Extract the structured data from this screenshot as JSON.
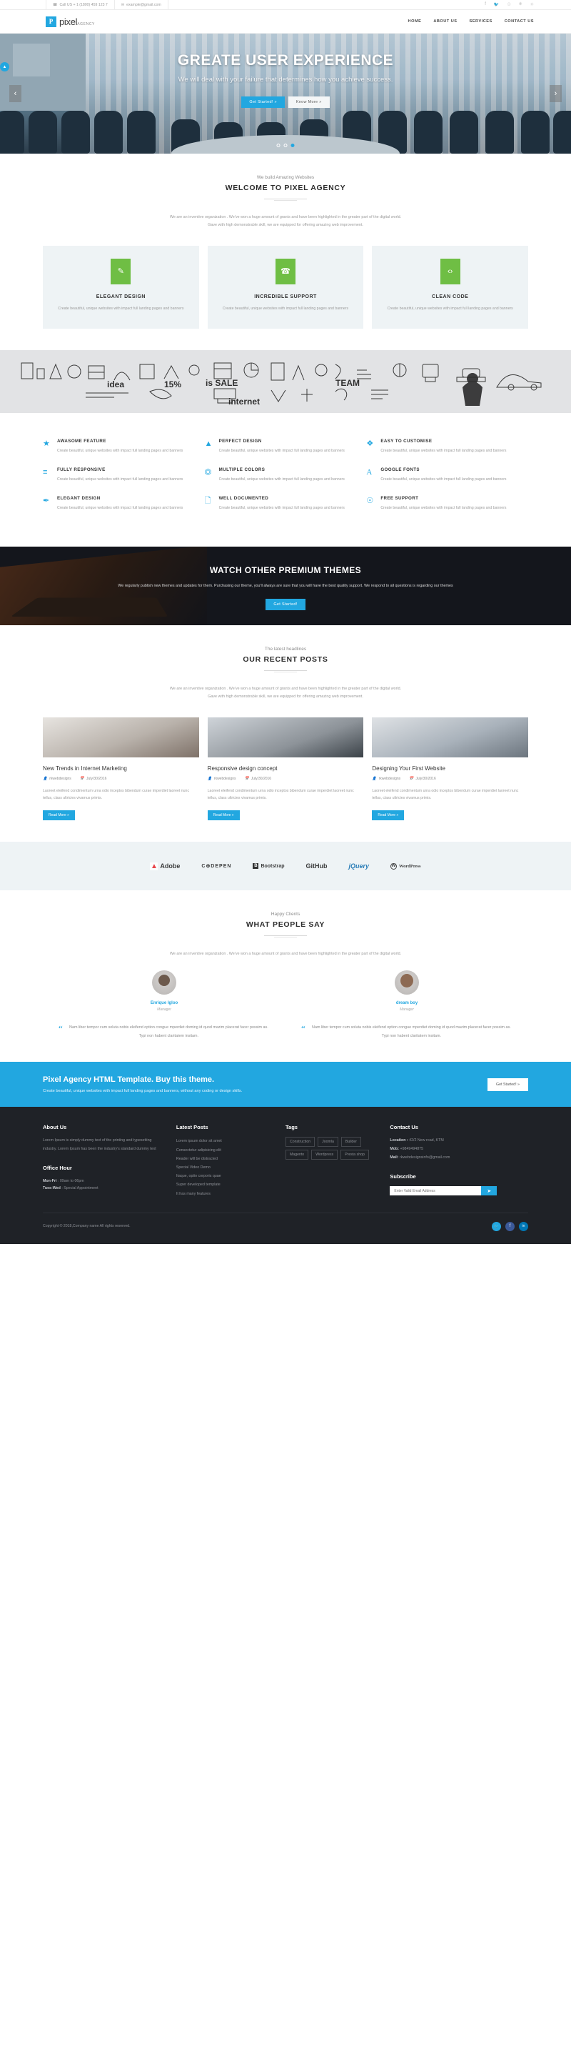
{
  "topbar": {
    "phone": "Call US + 1 (1800) 459 123 7",
    "email": "example@gmail.com",
    "socials": [
      "f",
      "✉",
      "ⓟ",
      "Ⓖ",
      "ⓖ"
    ]
  },
  "brand": {
    "mark": "P",
    "name": "pixel",
    "suffix": "AGENCY"
  },
  "nav": {
    "items": [
      "HOME",
      "ABOUT US",
      "SERVICES",
      "CONTACT US"
    ]
  },
  "hero": {
    "title": "GREATE USER EXPERIENCE",
    "subtitle": "We will deal with your failure that determines how you achieve success.",
    "primary_btn": "Get Started! »",
    "secondary_btn": "Know More »",
    "prev": "‹",
    "next": "›",
    "badge": "▲"
  },
  "welcome": {
    "eyebrow": "We build Amazing Websites",
    "title": "WELCOME TO PIXEL AGENCY",
    "desc_line1": "We are an inventive organization . We've won a huge amount of grants and have been highlighted in the greater part of the digital world.",
    "desc_line2": "Gave with high demonstrable skill, we are equipped for offering amazing web improvement.",
    "cards": [
      {
        "icon": "brush-icon",
        "glyph": "✎",
        "title": "ELEGANT DESIGN",
        "desc": "Create beautiful, unique websites with impact full landing pages and banners"
      },
      {
        "icon": "phone-icon",
        "glyph": "☎",
        "title": "INCREDIBLE SUPPORT",
        "desc": "Create beautiful, unique websites with impact full landing pages and banners"
      },
      {
        "icon": "code-icon",
        "glyph": "‹›",
        "title": "CLEAN CODE",
        "desc": "Create beautiful, unique websites with impact full landing pages and banners"
      }
    ]
  },
  "features": [
    {
      "icon": "star-icon",
      "glyph": "★",
      "title": "AWASOME FEATURE",
      "desc": "Create beautiful, unique websites with impact full landing pages and banners"
    },
    {
      "icon": "graduation-cap-icon",
      "glyph": "Ἱ3",
      "title": "PERFECT DESIGN",
      "desc": "Create beautiful, unique websites with impact full landing pages and banners"
    },
    {
      "icon": "puzzle-icon",
      "glyph": "❖",
      "title": "EASY TO CUSTOMISE",
      "desc": "Create beautiful, unique websites with impact full landing pages and banners"
    },
    {
      "icon": "bars-icon",
      "glyph": "≡",
      "title": "FULLY RESPONSIVE",
      "desc": "Create beautiful, unique websites with impact full landing pages and banners"
    },
    {
      "icon": "crop-icon",
      "glyph": "⌘",
      "title": "MULTIPLE COLORS",
      "desc": "Create beautiful, unique websites with impact full landing pages and banners"
    },
    {
      "icon": "font-icon",
      "glyph": "A",
      "title": "GOOGLE FONTS",
      "desc": "Create beautiful, unique websites with impact full landing pages and banners"
    },
    {
      "icon": "paintbrush-icon",
      "glyph": "✒",
      "title": "ELEGANT DESIGN",
      "desc": "Create beautiful, unique websites with impact full landing pages and banners"
    },
    {
      "icon": "document-icon",
      "glyph": "☷",
      "title": "WELL DOCUMENTED",
      "desc": "Create beautiful, unique websites with impact full landing pages and banners"
    },
    {
      "icon": "lifebuoy-icon",
      "glyph": "☉",
      "title": "FREE SUPPORT",
      "desc": "Create beautiful, unique websites with impact full landing pages and banners"
    }
  ],
  "dark_cta": {
    "title": "WATCH OTHER PREMIUM THEMES",
    "desc": "We regularly publish new themes and updates for them. Purchasing our theme, you'll always are sure that you will have the best quality support. We respond to all questions is regarding our themes",
    "btn": "Get Started!"
  },
  "blog": {
    "eyebrow": "The latest headlines",
    "title": "OUR RECENT POSTS",
    "desc_line1": "We are an inventive organization . We've won a huge amount of grants and have been highlighted in the greater part of the digital world.",
    "desc_line2": "Gave with high demonstrable skill, we are equipped for offering amazing web improvement.",
    "posts": [
      {
        "title": "New Trends in Internet Marketing",
        "author": "rkwebdesigns",
        "date": "July/30/2016",
        "excerpt": "Laoreet eleifend condimentum urna odio inceptos bibendum curae imperdiet laoreet nunc tellus, class ultricies vivamus primis.",
        "btn": "Read More »"
      },
      {
        "title": "Responsive design concept",
        "author": "rkwebdesigns",
        "date": "July/30/2016",
        "excerpt": "Laoreet eleifend condimentum urna odio inceptos bibendum curae imperdiet laoreet nunc tellus, class ultricies vivamus primis.",
        "btn": "Read More »"
      },
      {
        "title": "Designing Your First Website",
        "author": "rkwebdesigns",
        "date": "July/30/2016",
        "excerpt": "Laoreet eleifend condimentum urna odio inceptos bibendum curae imperdiet laoreet nunc tellus, class ultricies vivamus primis.",
        "btn": "Read More »"
      }
    ]
  },
  "clients": [
    {
      "name": "Adobe",
      "icon": "adobe-logo"
    },
    {
      "name": "C⊕DEPEN",
      "icon": "codepen-logo"
    },
    {
      "name": "Bootstrap",
      "icon": "bootstrap-logo"
    },
    {
      "name": "GitHub",
      "icon": "github-logo"
    },
    {
      "name": "jQuery",
      "icon": "jquery-logo"
    },
    {
      "name": "WordPress",
      "icon": "wordpress-logo"
    }
  ],
  "testimonials": {
    "eyebrow": "Happy Clients",
    "title": "WHAT PEOPLE SAY",
    "desc": "We are an inventive organization . We've won a huge amount of grants and have been highlighted in the greater part of the digital world.",
    "items": [
      {
        "name": "Enrique Igloo",
        "role": "Manager",
        "quote": "Nam liber tempor cum soluta nobis eleifend option congue mperdiet doming id quod mazim placerat facer possim as. Typi non habent claritatem insitam."
      },
      {
        "name": "dream boy",
        "role": "Manager",
        "quote": "Nam liber tempor cum soluta nobis eleifend option congue mperdiet doming id quod mazim placerat facer possim as. Typi non habent claritatem insitam."
      }
    ]
  },
  "blue_cta": {
    "title": "Pixel Agency HTML Template. Buy this theme.",
    "desc": "Create beautiful, unique websites with impact full landing pages and banners, without any coding or design skills.",
    "btn": "Get Started! »"
  },
  "footer": {
    "about": {
      "title": "About Us",
      "text": "Lorem Ipsum is simply dummy text of the printing and typesetting industry. Lorem Ipsum has been the industry's standard dummy text"
    },
    "office": {
      "title": "Office Hour",
      "line1_label": "Mon-Fri",
      "line1_value": ": 09am to 06pm",
      "line2_label": "Tues-Wed",
      "line2_value": ": Special Appointment"
    },
    "latest": {
      "title": "Latest Posts",
      "items": [
        "Lorem ipsum dolor sit amet",
        "Consectetur adipisicing elit",
        "Reader will be distracted",
        "Special Video Demo",
        "Itaque, optio corporis quae",
        "Super developed template",
        "It has many features"
      ]
    },
    "tags": {
      "title": "Tags",
      "items": [
        "Construction",
        "Joomla",
        "Builder",
        "Magento",
        "Wordpress",
        "Presta shop"
      ]
    },
    "contact": {
      "title": "Contact Us",
      "location_label": "Location :",
      "location_value": "42/2 New road, KTM",
      "mob_label": "Mob:",
      "mob_value": "+9849494875",
      "mail_label": "Mail:",
      "mail_value": "rkwebdesignsinfo@gmail.com"
    },
    "subscribe": {
      "title": "Subscribe",
      "placeholder": "Enter Valid Email Address",
      "btn_icon": "send-icon",
      "btn_glyph": "➤"
    },
    "copyright": "Copyright © 2018,Company name All rights reserved.",
    "socials": [
      "ᵗ",
      "f",
      "in"
    ]
  },
  "colors": {
    "accent": "#22a7e0",
    "green": "#6fbe44",
    "dark": "#1f2227"
  }
}
